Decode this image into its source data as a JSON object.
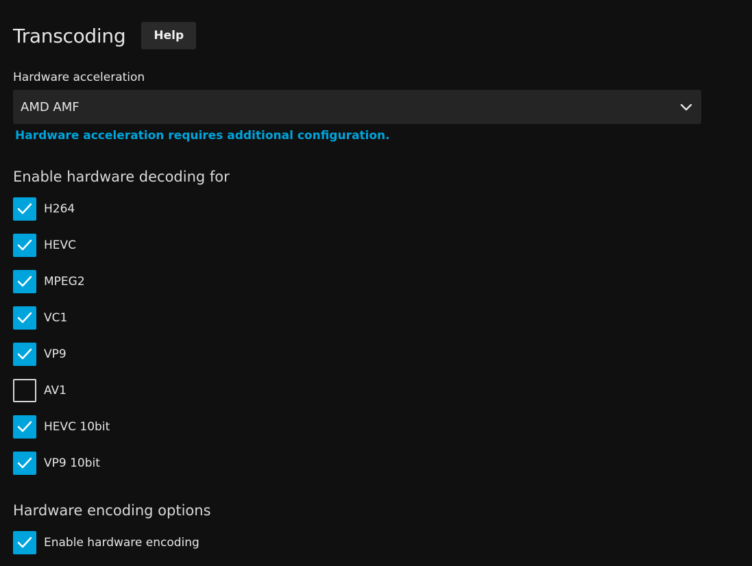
{
  "header": {
    "title": "Transcoding",
    "help_label": "Help"
  },
  "hw_accel": {
    "label": "Hardware acceleration",
    "selected": "AMD AMF",
    "hint": "Hardware acceleration requires additional configuration."
  },
  "decoding": {
    "heading": "Enable hardware decoding for",
    "codecs": [
      {
        "label": "H264",
        "checked": true
      },
      {
        "label": "HEVC",
        "checked": true
      },
      {
        "label": "MPEG2",
        "checked": true
      },
      {
        "label": "VC1",
        "checked": true
      },
      {
        "label": "VP9",
        "checked": true
      },
      {
        "label": "AV1",
        "checked": false
      },
      {
        "label": "HEVC 10bit",
        "checked": true
      },
      {
        "label": "VP9 10bit",
        "checked": true
      }
    ]
  },
  "encoding": {
    "heading": "Hardware encoding options",
    "enable_label": "Enable hardware encoding",
    "enable_checked": true
  },
  "colors": {
    "accent": "#00a4dc",
    "background": "#101010",
    "input_bg": "#252525"
  }
}
